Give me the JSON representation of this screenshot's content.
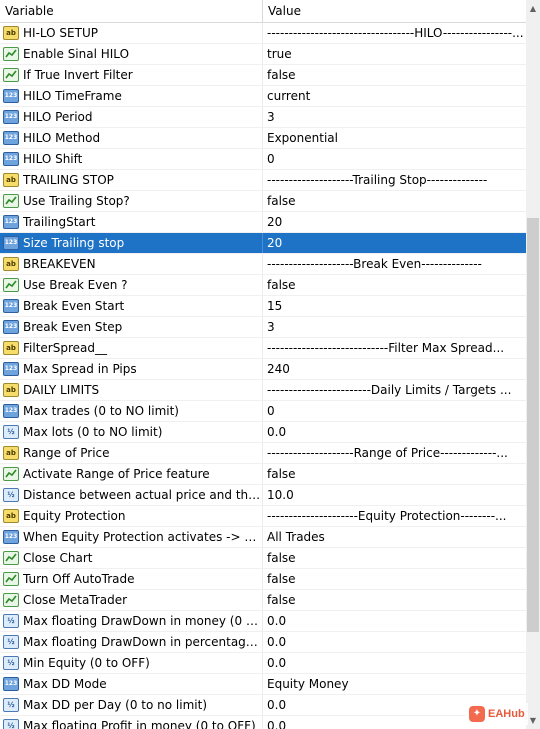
{
  "header": {
    "variable": "Variable",
    "value": "Value"
  },
  "selected_index": 10,
  "rows": [
    {
      "icon": "ab",
      "label": "HI-LO SETUP",
      "value": "----------------------------------HILO----------------..."
    },
    {
      "icon": "bool",
      "label": "Enable Sinal  HILO",
      "value": "true"
    },
    {
      "icon": "bool",
      "label": "If True Invert Filter",
      "value": "false"
    },
    {
      "icon": "num",
      "label": "HILO TimeFrame",
      "value": "current"
    },
    {
      "icon": "num",
      "label": "HILO Period",
      "value": "3"
    },
    {
      "icon": "num",
      "label": "HILO Method",
      "value": "Exponential"
    },
    {
      "icon": "num",
      "label": "HILO Shift",
      "value": "0"
    },
    {
      "icon": "ab",
      "label": "TRAILING STOP",
      "value": "--------------------Trailing Stop--------------"
    },
    {
      "icon": "bool",
      "label": "Use Trailing Stop?",
      "value": "false"
    },
    {
      "icon": "num",
      "label": "TrailingStart",
      "value": "20"
    },
    {
      "icon": "num",
      "label": "Size Trailing stop",
      "value": "20"
    },
    {
      "icon": "ab",
      "label": "BREAKEVEN",
      "value": "--------------------Break Even--------------"
    },
    {
      "icon": "bool",
      "label": "Use Break Even ?",
      "value": "false"
    },
    {
      "icon": "num",
      "label": "Break Even Start",
      "value": "15"
    },
    {
      "icon": "num",
      "label": "Break Even Step",
      "value": "3"
    },
    {
      "icon": "ab",
      "label": "FilterSpread__",
      "value": "----------------------------Filter Max Spread..."
    },
    {
      "icon": "num",
      "label": "Max Spread in Pips",
      "value": "240"
    },
    {
      "icon": "ab",
      "label": "DAILY LIMITS",
      "value": "------------------------Daily Limits / Targets ..."
    },
    {
      "icon": "num",
      "label": "Max trades (0 to NO limit)",
      "value": "0"
    },
    {
      "icon": "dbl",
      "label": "Max lots (0 to NO limit)",
      "value": "0.0"
    },
    {
      "icon": "ab",
      "label": "Range of Price",
      "value": "--------------------Range of Price-------------..."
    },
    {
      "icon": "bool",
      "label": "Activate Range of Price feature",
      "value": "false"
    },
    {
      "icon": "dbl",
      "label": "Distance between actual price and the i...",
      "value": "10.0"
    },
    {
      "icon": "ab",
      "label": "Equity Protection",
      "value": "---------------------Equity Protection--------..."
    },
    {
      "icon": "num",
      "label": "When Equity Protection activates -> Cl...",
      "value": "All Trades"
    },
    {
      "icon": "bool",
      "label": "Close Chart",
      "value": "false"
    },
    {
      "icon": "bool",
      "label": "Turn Off AutoTrade",
      "value": "false"
    },
    {
      "icon": "bool",
      "label": "Close MetaTrader",
      "value": "false"
    },
    {
      "icon": "dbl",
      "label": "Max floating DrawDown in money (0 to ...",
      "value": "0.0"
    },
    {
      "icon": "dbl",
      "label": "Max floating DrawDown in percentage ...",
      "value": "0.0"
    },
    {
      "icon": "dbl",
      "label": "Min Equity (0 to OFF)",
      "value": "0.0"
    },
    {
      "icon": "num",
      "label": "Max DD Mode",
      "value": "Equity Money"
    },
    {
      "icon": "dbl",
      "label": "Max DD per Day (0 to no limit)",
      "value": "0.0"
    },
    {
      "icon": "dbl",
      "label": "Max floating Profit in money (0 to OFF)",
      "value": "0.0"
    }
  ],
  "icon_text": {
    "ab": "ab",
    "num": "123",
    "dbl": "½"
  },
  "watermark": {
    "logo": "✦",
    "text": "EAHub"
  },
  "colors": {
    "selected_bg": "#1e73c6",
    "selected_text": "#ffffff"
  }
}
